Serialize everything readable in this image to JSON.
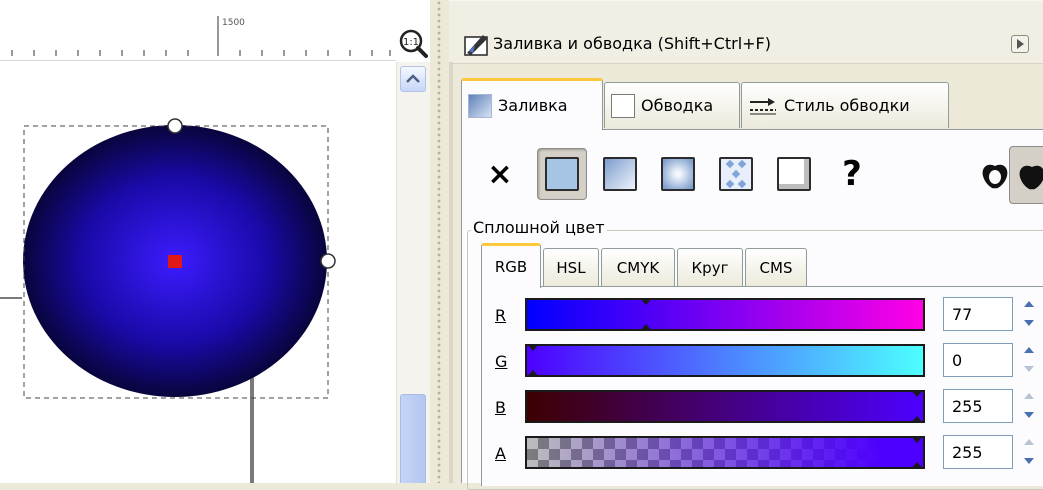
{
  "canvas": {
    "ruler_label": "1500",
    "zoom_icon": "zoom-1-1-icon"
  },
  "dialog": {
    "title": "Заливка и обводка (Shift+Ctrl+F)",
    "tabs": [
      {
        "label": "Заливка",
        "active": true
      },
      {
        "label": "Обводка"
      },
      {
        "label": "Стиль обводки"
      }
    ],
    "fill_modes": [
      "none",
      "flat",
      "linear",
      "radial",
      "pattern",
      "swatch",
      "unset"
    ],
    "active_mode": "flat",
    "unset_glyph": "?",
    "none_glyph": "×",
    "flat_color_label": "Сплошной цвет",
    "color_tabs": [
      "RGB",
      "HSL",
      "CMYK",
      "Круг",
      "CMS"
    ],
    "active_color_tab": "RGB",
    "channels": [
      {
        "label": "R",
        "value": "77",
        "fraction": 0.3
      },
      {
        "label": "G",
        "value": "0",
        "fraction": 0.0
      },
      {
        "label": "B",
        "value": "255",
        "fraction": 1.0
      },
      {
        "label": "A",
        "value": "255",
        "fraction": 1.0
      }
    ],
    "colors": {
      "current_fill": "#4d00ff",
      "tab_accent": "#ffc83c"
    }
  }
}
